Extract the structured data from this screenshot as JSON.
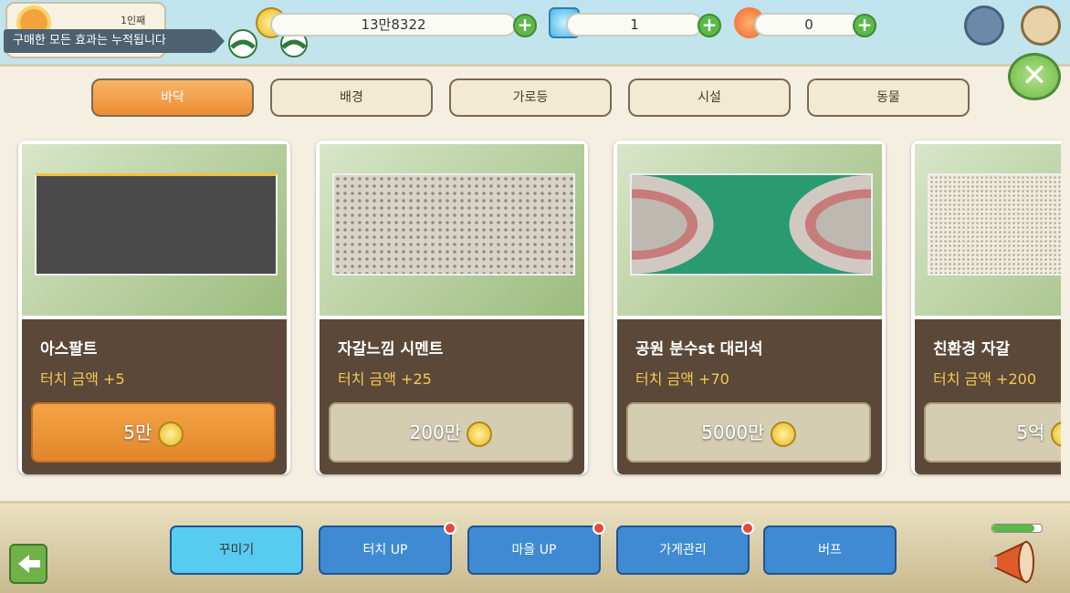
{
  "top": {
    "profile_rank": "1인째",
    "tooltip": "구매한 모든 효과는 누적됩니다",
    "coins": "13만8322",
    "gems": "1",
    "fruit": "0",
    "colors": {
      "gold": "#e9b91d",
      "gem": "#4ab6e8",
      "fruit": "#f0642b"
    }
  },
  "tabs": [
    {
      "label": "바닥",
      "active": true
    },
    {
      "label": "배경"
    },
    {
      "label": "가로등"
    },
    {
      "label": "시설"
    },
    {
      "label": "동물"
    }
  ],
  "cards": [
    {
      "name": "아스팔트",
      "bonus": "터치 금액 +5",
      "price": "5만",
      "texture": "asphalt",
      "buyable": true
    },
    {
      "name": "자갈느낌 시멘트",
      "bonus": "터치 금액 +25",
      "price": "200만",
      "texture": "gravel"
    },
    {
      "name": "공원 분수st 대리석",
      "bonus": "터치 금액 +70",
      "price": "5000만",
      "texture": "marble"
    },
    {
      "name": "친환경 자갈",
      "bonus": "터치 금액 +200",
      "price": "5억",
      "texture": "eco"
    }
  ],
  "bottom_nav": [
    {
      "label": "꾸미기",
      "active": true
    },
    {
      "label": "터치 UP",
      "badge": true
    },
    {
      "label": "마을 UP",
      "badge": true
    },
    {
      "label": "가게관리",
      "badge": true
    },
    {
      "label": "버프"
    }
  ],
  "megaphone_gauge": 0.85
}
